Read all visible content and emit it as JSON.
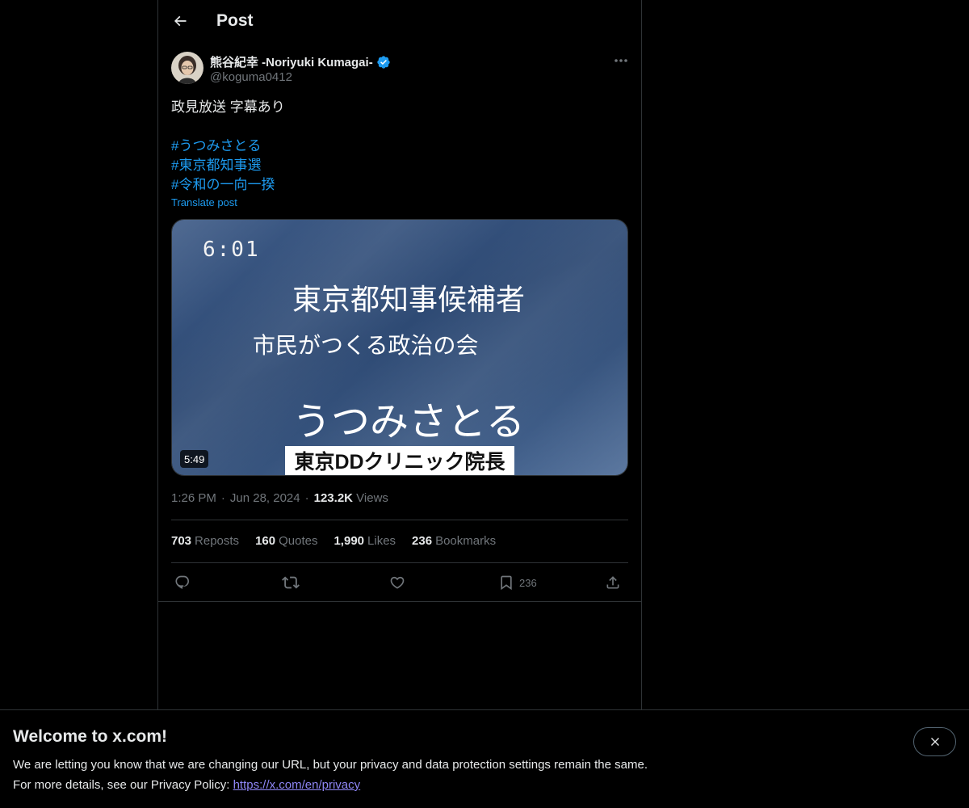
{
  "header": {
    "title": "Post"
  },
  "author": {
    "display_name": "熊谷紀幸 -Noriyuki Kumagai-",
    "handle": "@koguma0412",
    "verified_color": "#1d9bf0"
  },
  "tweet": {
    "text": "政見放送 字幕あり",
    "hashtags": [
      "#うつみさとる",
      "#東京都知事選",
      "#令和の一向一揆"
    ],
    "translate_label": "Translate post"
  },
  "media": {
    "video_time": "6:01",
    "line1": "東京都知事候補者",
    "line2": "市民がつくる政治の会",
    "line3": "うつみさとる",
    "caption": "東京DDクリニック院長",
    "duration": "5:49"
  },
  "meta": {
    "time": "1:26 PM",
    "dot1": "·",
    "date": "Jun 28, 2024",
    "dot2": "·",
    "views_count": "123.2K",
    "views_label": "Views"
  },
  "stats": [
    {
      "count": "703",
      "label": "Reposts"
    },
    {
      "count": "160",
      "label": "Quotes"
    },
    {
      "count": "1,990",
      "label": "Likes"
    },
    {
      "count": "236",
      "label": "Bookmarks"
    }
  ],
  "actions": {
    "reply_icon": "reply-icon",
    "repost_icon": "repost-icon",
    "like_icon": "heart-icon",
    "bookmark_icon": "bookmark-icon",
    "bookmark_count": "236",
    "share_icon": "share-icon"
  },
  "banner": {
    "title": "Welcome to x.com!",
    "text1": "We are letting you know that we are changing our URL, but your privacy and data protection settings remain the same.",
    "text2_prefix": "For more details, see our Privacy Policy: ",
    "link": "https://x.com/en/privacy"
  },
  "colors": {
    "background": "#000000",
    "accent": "#1d9bf0",
    "muted": "#71767b",
    "border": "#2f3336",
    "link_visited": "#8e86f5"
  }
}
